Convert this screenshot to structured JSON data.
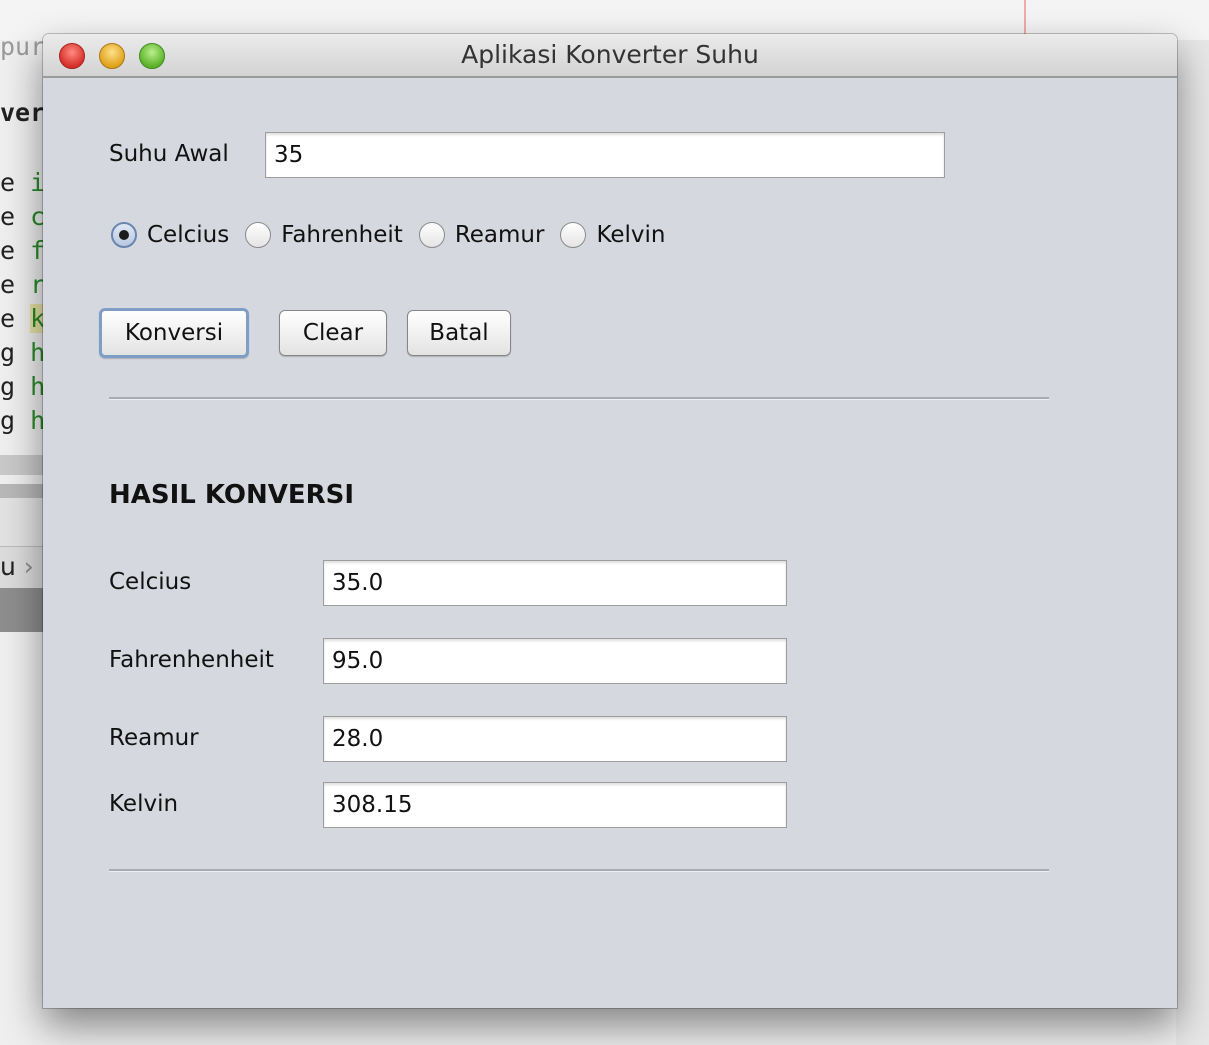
{
  "background": {
    "top_text": "pur",
    "bold_text": "ver",
    "code_lines": [
      {
        "a": "e",
        "b": "i"
      },
      {
        "a": "e",
        "b": "c"
      },
      {
        "a": "e",
        "b": "f"
      },
      {
        "a": "e",
        "b": "r"
      },
      {
        "a": "e",
        "b": "k"
      },
      {
        "a": "g",
        "b": "h"
      },
      {
        "a": "g",
        "b": "h"
      },
      {
        "a": "g",
        "b": "h"
      }
    ],
    "breadcrumb_text": "u"
  },
  "window": {
    "title": "Aplikasi Konverter Suhu"
  },
  "input": {
    "label": "Suhu Awal",
    "value": "35"
  },
  "units": {
    "options": [
      "Celcius",
      "Fahrenheit",
      "Reamur",
      "Kelvin"
    ],
    "selected": "Celcius"
  },
  "buttons": {
    "convert": "Konversi",
    "clear": "Clear",
    "cancel": "Batal"
  },
  "results": {
    "heading": "HASIL KONVERSI",
    "celcius_label": "Celcius",
    "celcius_value": "35.0",
    "fahrenheit_label": "Fahrenhenheit",
    "fahrenheit_value": "95.0",
    "reamur_label": "Reamur",
    "reamur_value": "28.0",
    "kelvin_label": "Kelvin",
    "kelvin_value": "308.15"
  },
  "colors": {
    "window_bg": "#d5d8df",
    "focus_ring": "#7f9ec6",
    "close": "#d6302a",
    "minimize": "#e0a21a",
    "maximize": "#5cb22a"
  }
}
